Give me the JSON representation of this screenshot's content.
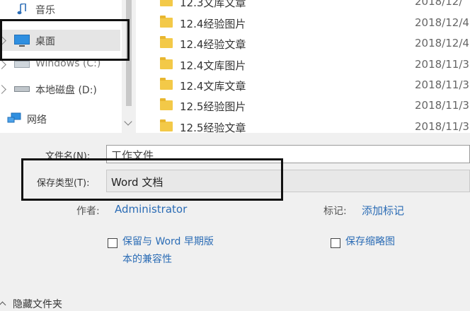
{
  "sidebar": {
    "items": [
      {
        "label": "音乐",
        "icon": "music-icon"
      },
      {
        "label": "桌面",
        "icon": "desktop-icon",
        "selected": true
      },
      {
        "label": "Windows (C:)",
        "icon": "windows-drive-icon"
      },
      {
        "label": "本地磁盘 (D:)",
        "icon": "local-drive-icon"
      },
      {
        "label": "网络",
        "icon": "network-icon"
      }
    ]
  },
  "files": [
    {
      "name": "12.3文库文章",
      "date": "2018/12/"
    },
    {
      "name": "12.4经验图片",
      "date": "2018/12/4"
    },
    {
      "name": "12.4经验文章",
      "date": "2018/12/4"
    },
    {
      "name": "12.4文库图片",
      "date": "2018/11/3"
    },
    {
      "name": "12.4文库文章",
      "date": "2018/11/3"
    },
    {
      "name": "12.5经验图片",
      "date": "2018/11/3"
    },
    {
      "name": "12.5经验文章",
      "date": "2018/11/3"
    }
  ],
  "form": {
    "filename_label": "文件名(N):",
    "filename_value": "工作文件",
    "filetype_label": "保存类型(T):",
    "filetype_value": "Word 文档",
    "author_label": "作者:",
    "author_value": "Administrator",
    "tags_label": "标记:",
    "tags_value": "添加标记",
    "compat_line1": "保留与 Word 早期版",
    "compat_line2": "本的兼容性",
    "thumbnail_label": "保存缩略图"
  },
  "footer": {
    "hide_folders_label": "隐藏文件夹"
  },
  "colors": {
    "link": "#2b6cb5",
    "folder": "#f3c948",
    "desktop_icon": "#2f8fe0",
    "selected_bg": "#e5e5e5"
  }
}
